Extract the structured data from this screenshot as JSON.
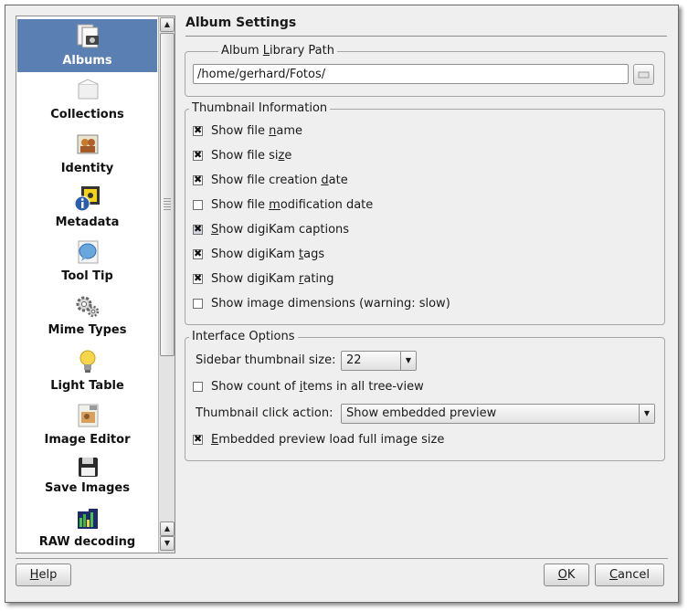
{
  "sidebar": {
    "items": [
      {
        "label": "Albums",
        "icon": "albums-icon"
      },
      {
        "label": "Collections",
        "icon": "collections-icon"
      },
      {
        "label": "Identity",
        "icon": "identity-icon"
      },
      {
        "label": "Metadata",
        "icon": "metadata-icon"
      },
      {
        "label": "Tool Tip",
        "icon": "tooltip-icon"
      },
      {
        "label": "Mime Types",
        "icon": "mime-types-icon"
      },
      {
        "label": "Light Table",
        "icon": "light-table-icon"
      },
      {
        "label": "Image Editor",
        "icon": "image-editor-icon"
      },
      {
        "label": "Save Images",
        "icon": "save-images-icon"
      },
      {
        "label": "RAW decoding",
        "icon": "raw-decoding-icon"
      }
    ],
    "selected_index": 0,
    "selection_color": "#5a7fb3"
  },
  "page": {
    "title": "Album Settings",
    "library": {
      "legend_pre": "Album ",
      "legend_key": "L",
      "legend_post": "ibrary Path",
      "path_value": "/home/gerhard/Fotos/"
    },
    "thumbnail": {
      "legend": "Thumbnail Information",
      "options": [
        {
          "pre": "Show file ",
          "key": "n",
          "post": "ame",
          "checked": true
        },
        {
          "pre": "Show file si",
          "key": "z",
          "post": "e",
          "checked": true
        },
        {
          "pre": "Show file creation ",
          "key": "d",
          "post": "ate",
          "checked": true
        },
        {
          "pre": "Show file ",
          "key": "m",
          "post": "odification date",
          "checked": false
        },
        {
          "pre": "",
          "key": "S",
          "post": "how digiKam captions",
          "checked": true
        },
        {
          "pre": "Show digiKam ",
          "key": "t",
          "post": "ags",
          "checked": true
        },
        {
          "pre": "Show digiKam ",
          "key": "r",
          "post": "ating",
          "checked": true
        },
        {
          "pre": "Show image dimensions (warning: slow)",
          "key": "",
          "post": "",
          "checked": false
        }
      ]
    },
    "interface": {
      "legend": "Interface Options",
      "sidebar_size_label": "Sidebar thumbnail size:",
      "sidebar_size_value": "22",
      "count_pre": "Show count of ",
      "count_key": "i",
      "count_post": "tems in all tree-view",
      "count_checked": false,
      "click_action_label": "Thumbnail click action:",
      "click_action_value": "Show embedded preview",
      "embedded_key": "E",
      "embedded_post": "mbedded preview load full image size",
      "embedded_checked": true
    }
  },
  "buttons": {
    "help_key": "H",
    "help_post": "elp",
    "ok_key": "O",
    "ok_post": "K",
    "cancel_key": "C",
    "cancel_post": "ancel"
  }
}
